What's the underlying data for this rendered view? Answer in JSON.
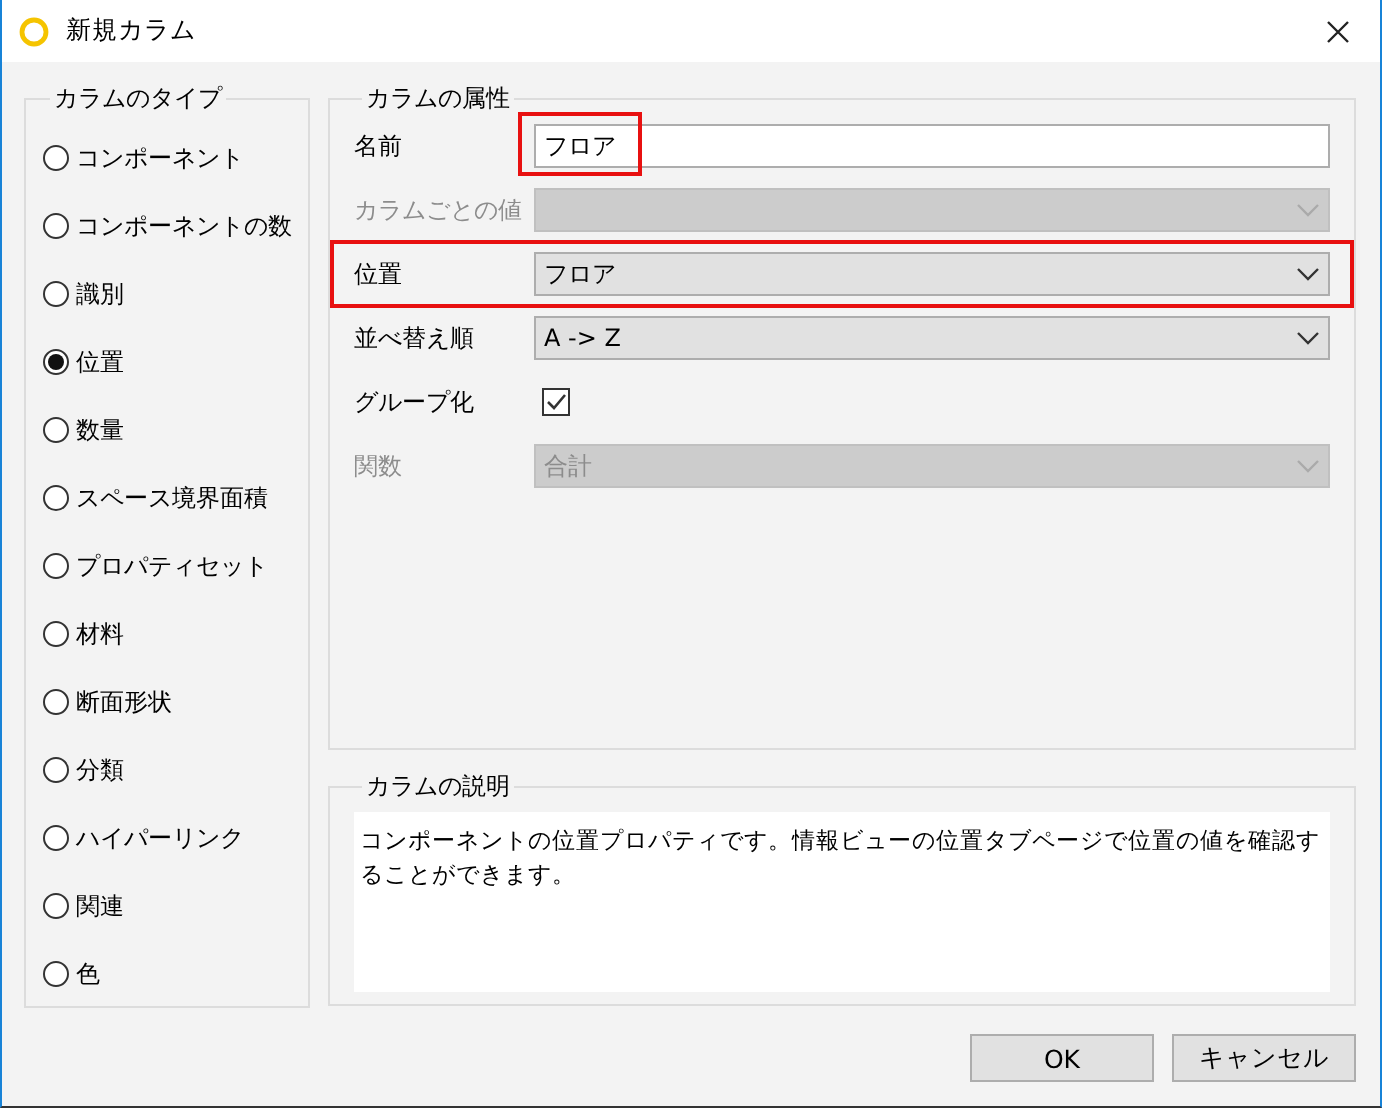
{
  "window": {
    "title": "新規カラム"
  },
  "column_type": {
    "legend": "カラムのタイプ",
    "options": [
      {
        "label": "コンポーネント",
        "selected": false
      },
      {
        "label": "コンポーネントの数",
        "selected": false
      },
      {
        "label": "識別",
        "selected": false
      },
      {
        "label": "位置",
        "selected": true
      },
      {
        "label": "数量",
        "selected": false
      },
      {
        "label": "スペース境界面積",
        "selected": false
      },
      {
        "label": "プロパティセット",
        "selected": false
      },
      {
        "label": "材料",
        "selected": false
      },
      {
        "label": "断面形状",
        "selected": false
      },
      {
        "label": "分類",
        "selected": false
      },
      {
        "label": "ハイパーリンク",
        "selected": false
      },
      {
        "label": "関連",
        "selected": false
      },
      {
        "label": "色",
        "selected": false
      }
    ]
  },
  "attributes": {
    "legend": "カラムの属性",
    "rows": [
      {
        "kind": "text",
        "label": "名前",
        "value": "フロア",
        "disabled": false,
        "highlighted": true
      },
      {
        "kind": "select",
        "label": "カラムごとの値",
        "disabled": true,
        "highlighted": false
      },
      {
        "kind": "select",
        "label": "位置",
        "value": "フロア",
        "disabled": false,
        "highlighted": true
      },
      {
        "kind": "select",
        "label": "並べ替え順",
        "value": "A -> Z",
        "disabled": false,
        "highlighted": false
      },
      {
        "kind": "checkbox",
        "label": "グループ化",
        "checked": true,
        "disabled": false,
        "highlighted": false
      },
      {
        "kind": "select",
        "label": "関数",
        "value": "合計",
        "disabled": true,
        "highlighted": false
      }
    ]
  },
  "description": {
    "legend": "カラムの説明",
    "text": "コンポーネントの位置プロパティです。情報ビューの位置タブページで位置の値を確認することができます。"
  },
  "buttons": [
    "OK",
    "キャンセル"
  ]
}
